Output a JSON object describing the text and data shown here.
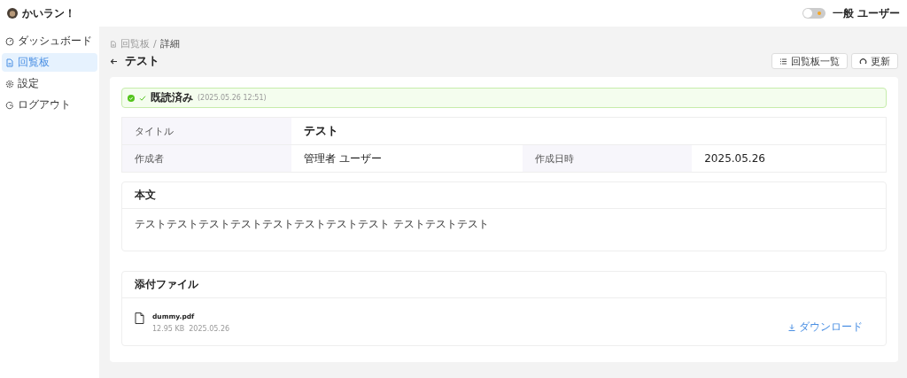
{
  "app": {
    "name": "かいラン！"
  },
  "theme_toggle": {
    "on": false
  },
  "user": {
    "role": "一般 ユーザー"
  },
  "sidebar": {
    "items": [
      {
        "label": "ダッシュボード",
        "selected": false
      },
      {
        "label": "回覧板",
        "selected": true
      },
      {
        "label": "設定",
        "selected": false
      },
      {
        "label": "ログアウト",
        "selected": false
      }
    ]
  },
  "breadcrumb": [
    {
      "label": "回覧板",
      "current": false
    },
    {
      "label": "詳細",
      "current": true
    }
  ],
  "breadcrumb_separator": "/",
  "page_title": "テスト",
  "actions": [
    {
      "label": "回覧板一覧"
    },
    {
      "label": "更新"
    }
  ],
  "read_status": {
    "read": true,
    "label": "既読済み",
    "time": "(2025.05.26 12:51)"
  },
  "details": {
    "title_label": "タイトル",
    "title": "テスト",
    "fields": [
      {
        "label": "作成者",
        "value": "管理者 ユーザー"
      },
      {
        "label": "作成日時",
        "value": "2025.05.26"
      }
    ]
  },
  "body": {
    "heading": "本文",
    "text": "テストテストテストテストテストテストテストテスト テストテストテスト"
  },
  "attachments": {
    "heading": "添付ファイル",
    "files": [
      {
        "name": "dummy.pdf",
        "size": "12.95 KB",
        "date": "2025.05.26",
        "action": "ダウンロード"
      }
    ]
  }
}
